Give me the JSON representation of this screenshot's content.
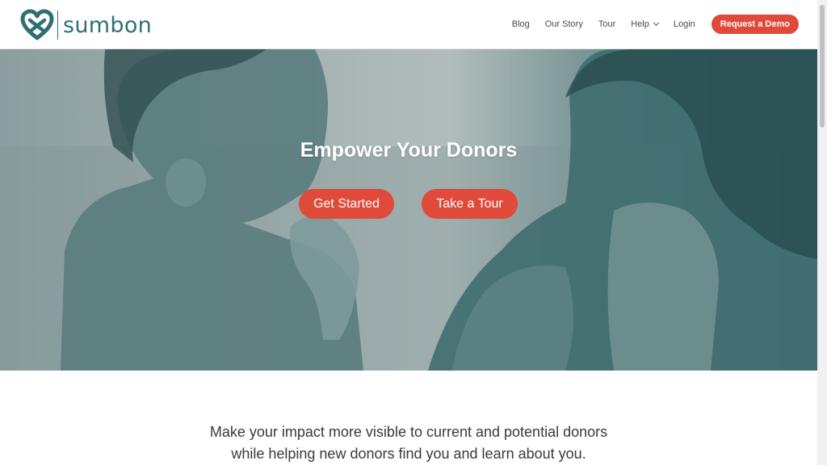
{
  "brand": {
    "name": "sumbon",
    "color": "#2f6f73"
  },
  "nav": {
    "items": [
      {
        "label": "Blog"
      },
      {
        "label": "Our Story"
      },
      {
        "label": "Tour"
      },
      {
        "label": "Help",
        "has_dropdown": true
      },
      {
        "label": "Login"
      }
    ],
    "demo_button": "Request a Demo"
  },
  "hero": {
    "title": "Empower Your Donors",
    "primary_cta": "Get Started",
    "secondary_cta": "Take a Tour",
    "accent_color": "#e04a3a"
  },
  "intro": {
    "line1": "Make your impact more visible to current and potential donors",
    "line2": "while helping new donors find you and learn about you."
  },
  "icons": [
    "heart-logo-icon",
    "chevron-down-icon"
  ]
}
